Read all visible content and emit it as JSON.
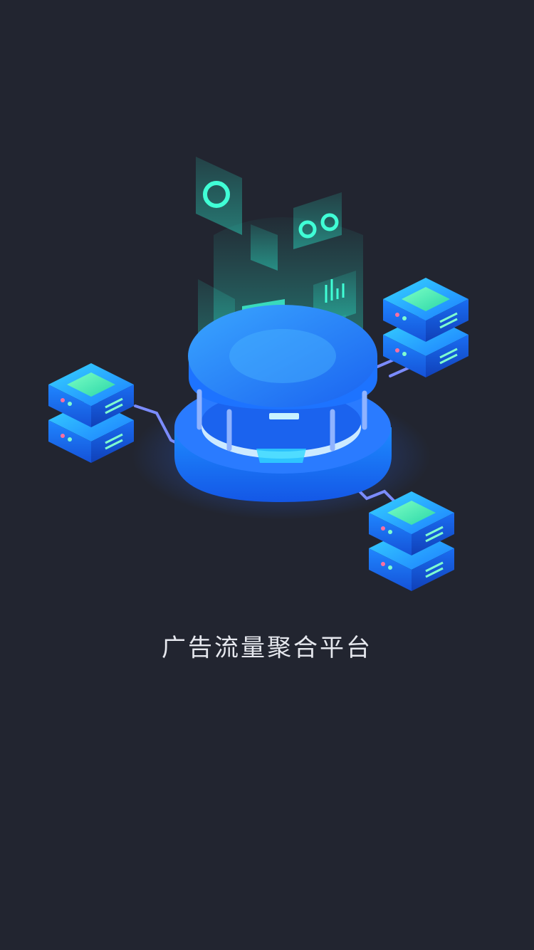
{
  "splash": {
    "title": "广告流量聚合平台"
  },
  "illustration": {
    "icon": "data-center-hub-illustration",
    "servers": [
      "server-rack-icon",
      "server-rack-icon",
      "server-rack-icon"
    ],
    "panels": [
      "donut-chart-icon",
      "ring-pair-icon",
      "bar-chart-icon",
      "document-icon"
    ]
  },
  "colors": {
    "background": "#222530",
    "accent_blue": "#1f7cff",
    "accent_cyan": "#2be0c6",
    "title_text": "#e6e8ee"
  }
}
